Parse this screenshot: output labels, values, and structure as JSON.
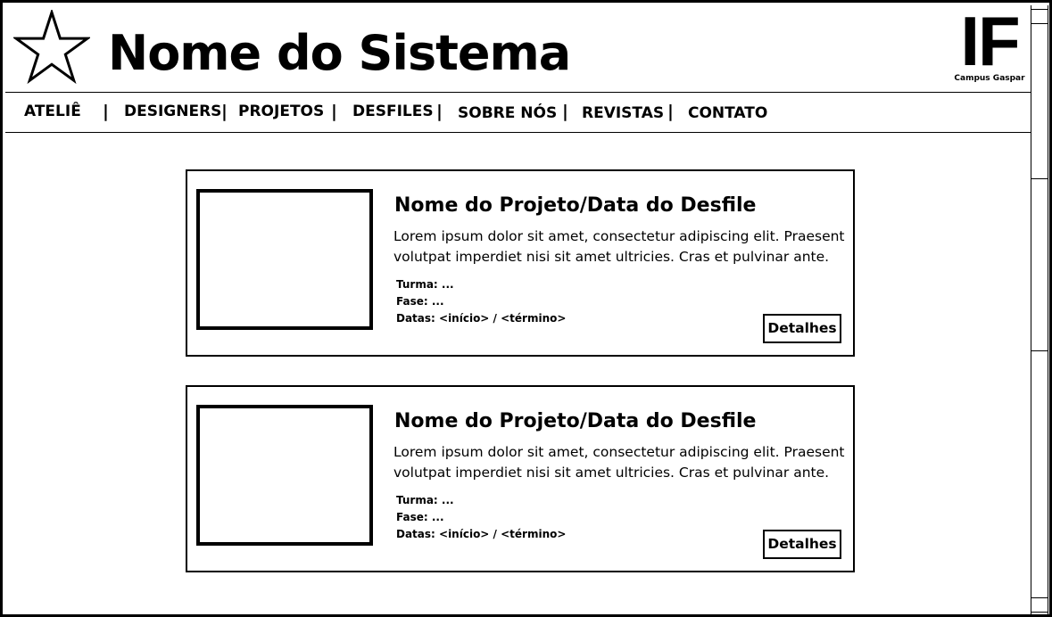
{
  "header": {
    "title": "Nome do Sistema",
    "logo_icon": "star-icon",
    "institution_mark": "IF",
    "institution_campus": "Campus Gaspar"
  },
  "nav": {
    "items": [
      {
        "label": "ATELIÊ"
      },
      {
        "label": "DESIGNERS"
      },
      {
        "label": "PROJETOS"
      },
      {
        "label": "DESFILES"
      },
      {
        "label": "SOBRE NÓS"
      },
      {
        "label": "REVISTAS"
      },
      {
        "label": "CONTATO"
      }
    ],
    "separator": "|"
  },
  "cards": [
    {
      "title": "Nome do Projeto/Data do Desfile",
      "description": "Lorem ipsum dolor sit amet, consectetur adipiscing elit. Praesent volutpat imperdiet nisi sit amet ultricies. Cras et pulvinar ante.",
      "turma": "Turma: ...",
      "fase": "Fase: ...",
      "datas": "Datas: <início> / <término>",
      "button": "Detalhes"
    },
    {
      "title": "Nome do Projeto/Data do Desfile",
      "description": "Lorem ipsum dolor sit amet, consectetur adipiscing elit. Praesent volutpat imperdiet nisi sit amet ultricies. Cras et pulvinar ante.",
      "turma": "Turma: ...",
      "fase": "Fase: ...",
      "datas": "Datas: <início> / <término>",
      "button": "Detalhes"
    }
  ]
}
